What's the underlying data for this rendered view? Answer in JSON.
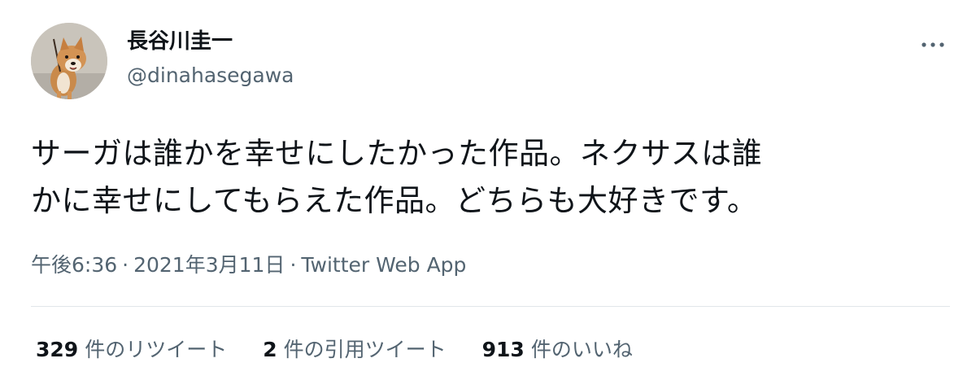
{
  "author": {
    "display_name": "長谷川圭一",
    "handle": "@dinahasegawa",
    "avatar_icon": "avatar-shiba-dog"
  },
  "tweet": {
    "text_lines": [
      "サーガは誰かを幸せにしたかった作品。ネクサスは誰",
      "かに幸せにしてもらえた作品。どちらも大好きです。"
    ],
    "time": "午後6:36",
    "date": "2021年3月11日",
    "source": "Twitter Web App",
    "separator": "·"
  },
  "stats": {
    "retweets": {
      "count": "329",
      "label": "件のリツイート"
    },
    "quotes": {
      "count": "2",
      "label": "件の引用ツイート"
    },
    "likes": {
      "count": "913",
      "label": "件のいいね"
    }
  },
  "icons": {
    "more": "more-horizontal-icon"
  },
  "colors": {
    "primary_text": "#0f1419",
    "secondary_text": "#536471",
    "divider": "#e1e6ea"
  }
}
